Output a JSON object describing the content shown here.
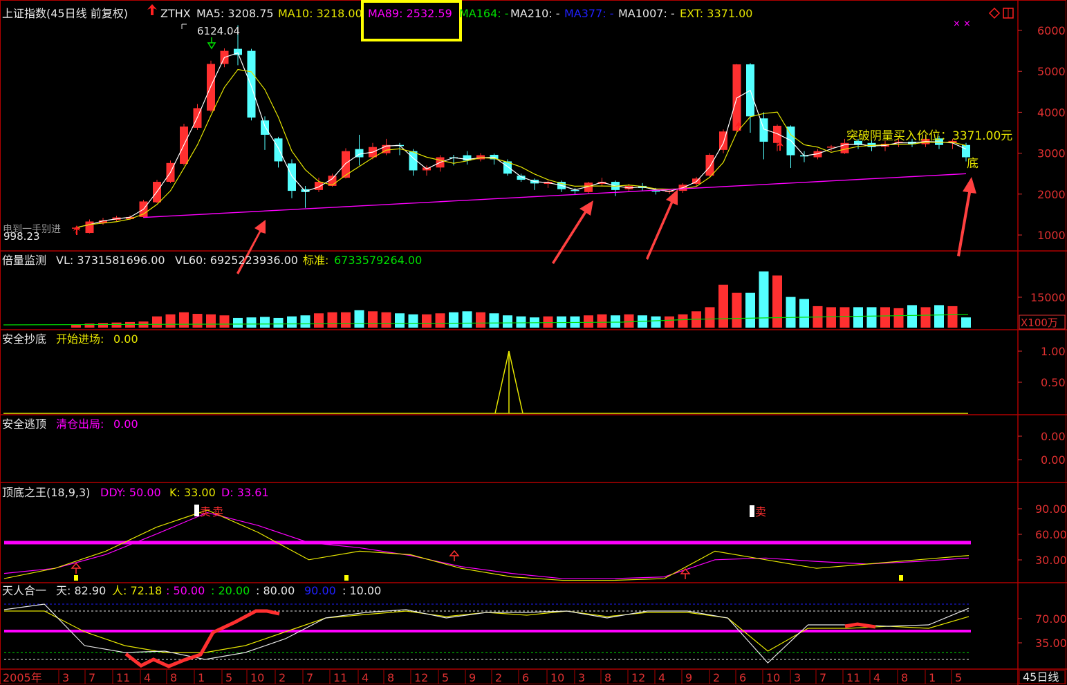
{
  "colors": {
    "bg": "#000000",
    "border": "#b00000",
    "grid": "#7a0000",
    "axis_text": "#e03030",
    "up": "#ff3030",
    "down": "#54ffff",
    "ma5": "#ffffff",
    "ma10": "#e6e600",
    "ma89": "#ff00ff",
    "green": "#00e000",
    "blue": "#2020ff",
    "white": "#e8e8e8",
    "highlight": "#ffff00",
    "arrow": "#ff4040"
  },
  "header": {
    "title": "上证指数(45日线 前复权)",
    "ind": "ZTHX",
    "ma5": "MA5: 3208.75",
    "ma10": "MA10: 3218.00",
    "ma89": "MA89: 2532.59",
    "ma164": "MA164: -",
    "ma210": "MA210: -",
    "ma377": "MA377: -",
    "ma1007": "MA1007: -",
    "ext": "EXT: 3371.00"
  },
  "price_panel": {
    "high_label": "6124.04",
    "low_label": "998.23",
    "buy_text": "突破阴量买入价位：3371.00元",
    "di_mark": "底",
    "left_cap": "电到一手别进",
    "y_ticks": [
      "6000",
      "5000",
      "4000",
      "3000",
      "2000",
      "1000"
    ]
  },
  "vol_panel": {
    "label": "倍量监测",
    "vl": "VL: 3731581696.00",
    "vl60": "VL60: 6925223936.00",
    "bz_key": "标准:",
    "bz_val": "6733579264.00",
    "y_tick": "15000",
    "unit": "X100万"
  },
  "chaodi_panel": {
    "label": "安全抄底",
    "key": "开始进场:",
    "val": "0.00",
    "ticks": [
      "1.00",
      "0.50"
    ]
  },
  "taoding_panel": {
    "label": "安全逃顶",
    "key": "清仓出局:",
    "val": "0.00",
    "ticks": [
      "0.00",
      "0.00"
    ]
  },
  "kdj_panel": {
    "label": "顶底之王(18,9,3)",
    "ddy": "DDY: 50.00",
    "k": "K: 33.00",
    "d": "D: 33.61",
    "ticks": [
      "90.00",
      "60.00",
      "30.00"
    ],
    "sell": "卖"
  },
  "trhy_panel": {
    "label": "天人合一",
    "tian": "天: 82.90",
    "ren": "人: 72.18",
    "v50": ": 50.00",
    "v20": ": 20.00",
    "v80": ": 80.00",
    "v90": "90.00",
    "v10": ": 10.00",
    "ticks": [
      "70.00",
      "35.00"
    ]
  },
  "xaxis": {
    "labels": [
      "2005年",
      "3",
      "7",
      "11",
      "4",
      "8",
      "1",
      "5",
      "10",
      "2",
      "7",
      "11",
      "4",
      "8",
      "12",
      "5",
      "9",
      "2",
      "6",
      "10",
      "3",
      "8",
      "12",
      "4",
      "9",
      "2",
      "6",
      "10",
      "3",
      "7",
      "11",
      "4",
      "8",
      "1",
      "5"
    ],
    "period": "45日线"
  },
  "chart_data": {
    "type": "candlestick",
    "title": "上证指数(45日线 前复权)",
    "period": "45-day bars, 2005 – latest",
    "ylim": [
      800,
      6300
    ],
    "candles": [
      [
        1155,
        1180,
        1090,
        1035
      ],
      [
        1050,
        1330,
        1380,
        1040
      ],
      [
        1290,
        1360,
        1420,
        1250
      ],
      [
        1370,
        1430,
        1470,
        1340
      ],
      [
        1390,
        1440,
        1480,
        1370
      ],
      [
        1440,
        1820,
        1860,
        1420
      ],
      [
        1800,
        2300,
        2350,
        1780
      ],
      [
        2300,
        2760,
        2820,
        2270
      ],
      [
        2740,
        3650,
        3720,
        2700
      ],
      [
        3620,
        4100,
        4200,
        3570
      ],
      [
        4040,
        5180,
        5260,
        4000
      ],
      [
        5180,
        5500,
        5560,
        5100
      ],
      [
        5550,
        5400,
        6124,
        5150
      ],
      [
        5500,
        3870,
        5550,
        3800
      ],
      [
        3800,
        3450,
        3900,
        3080
      ],
      [
        3360,
        2800,
        3400,
        2650
      ],
      [
        2750,
        2080,
        2850,
        1900
      ],
      [
        2120,
        2050,
        2200,
        1664
      ],
      [
        2100,
        2300,
        2400,
        2050
      ],
      [
        2200,
        2450,
        2500,
        2180
      ],
      [
        2400,
        3050,
        3120,
        2380
      ],
      [
        3100,
        2900,
        3450,
        2700
      ],
      [
        2900,
        3150,
        3250,
        2850
      ],
      [
        3000,
        3200,
        3350,
        2950
      ],
      [
        3200,
        3180,
        3250,
        2950
      ],
      [
        3050,
        2580,
        3100,
        2450
      ],
      [
        2580,
        2650,
        2700,
        2450
      ],
      [
        2650,
        2900,
        2950,
        2550
      ],
      [
        2900,
        2880,
        2960,
        2700
      ],
      [
        2950,
        2820,
        3050,
        2720
      ],
      [
        2850,
        2950,
        3000,
        2800
      ],
      [
        2960,
        2850,
        2990,
        2720
      ],
      [
        2800,
        2500,
        2850,
        2450
      ],
      [
        2450,
        2350,
        2500,
        2300
      ],
      [
        2350,
        2260,
        2380,
        2100
      ],
      [
        2250,
        2300,
        2330,
        2150
      ],
      [
        2300,
        2120,
        2330,
        2050
      ],
      [
        2100,
        2090,
        2150,
        1980
      ],
      [
        2050,
        2280,
        2300,
        2020
      ],
      [
        2250,
        2300,
        2400,
        2200
      ],
      [
        2300,
        2100,
        2330,
        1950
      ],
      [
        2120,
        2200,
        2250,
        2050
      ],
      [
        2200,
        2150,
        2270,
        2080
      ],
      [
        2100,
        2060,
        2150,
        1990
      ],
      [
        2050,
        2080,
        2120,
        2000
      ],
      [
        2080,
        2230,
        2270,
        2030
      ],
      [
        2250,
        2380,
        2420,
        2200
      ],
      [
        2450,
        2960,
        3000,
        2420
      ],
      [
        3080,
        3530,
        3580,
        3000
      ],
      [
        3550,
        5170,
        5178,
        3500
      ],
      [
        5170,
        3900,
        5200,
        3500
      ],
      [
        3850,
        3280,
        4000,
        2850
      ],
      [
        3250,
        3670,
        3700,
        3050
      ],
      [
        3650,
        2950,
        3680,
        2638
      ],
      [
        2950,
        2920,
        3050,
        2780
      ],
      [
        2900,
        3050,
        3100,
        2850
      ],
      [
        3150,
        3160,
        3200,
        3050
      ],
      [
        3000,
        3250,
        3350,
        2980
      ],
      [
        3300,
        3200,
        3350,
        3100
      ],
      [
        3250,
        3150,
        3320,
        3050
      ],
      [
        3160,
        3230,
        3300,
        3050
      ],
      [
        3250,
        3280,
        3350,
        3150
      ],
      [
        3280,
        3220,
        3350,
        3150
      ],
      [
        3220,
        3350,
        3450,
        3150
      ],
      [
        3360,
        3200,
        3420,
        3100
      ],
      [
        3250,
        3300,
        3350,
        3100
      ],
      [
        3200,
        2900,
        3250,
        2800
      ]
    ],
    "volume": [
      300,
      400,
      450,
      500,
      550,
      600,
      1100,
      1300,
      1500,
      1350,
      1300,
      1200,
      950,
      1000,
      1050,
      950,
      1100,
      1200,
      1400,
      1500,
      1500,
      1700,
      1600,
      1500,
      1400,
      1300,
      1300,
      1400,
      1500,
      1600,
      1500,
      1400,
      1200,
      1100,
      1000,
      1100,
      1100,
      1100,
      1200,
      1300,
      1200,
      1300,
      1200,
      1100,
      1100,
      1300,
      1600,
      2000,
      4200,
      3400,
      3400,
      5500,
      5100,
      3000,
      2800,
      2100,
      2000,
      2000,
      2000,
      2000,
      2000,
      1900,
      2200,
      2000,
      2200,
      2100,
      1000
    ],
    "kdj_k": [
      8,
      20,
      40,
      68,
      88,
      62,
      30,
      40,
      36,
      20,
      10,
      6,
      6,
      8,
      40,
      30,
      20,
      25,
      30,
      35
    ],
    "kdj_d": [
      14,
      20,
      36,
      60,
      85,
      70,
      50,
      44,
      35,
      22,
      14,
      8,
      8,
      10,
      30,
      32,
      28,
      25,
      28,
      32
    ],
    "tian": [
      82,
      90,
      30,
      20,
      22,
      10,
      20,
      40,
      70,
      78,
      82,
      70,
      78,
      78,
      80,
      70,
      80,
      80,
      70,
      5,
      60,
      60,
      58,
      60,
      84
    ],
    "ren": [
      80,
      80,
      50,
      30,
      20,
      20,
      30,
      50,
      70,
      75,
      80,
      72,
      78,
      74,
      80,
      72,
      78,
      78,
      70,
      22,
      55,
      55,
      58,
      55,
      72
    ]
  }
}
